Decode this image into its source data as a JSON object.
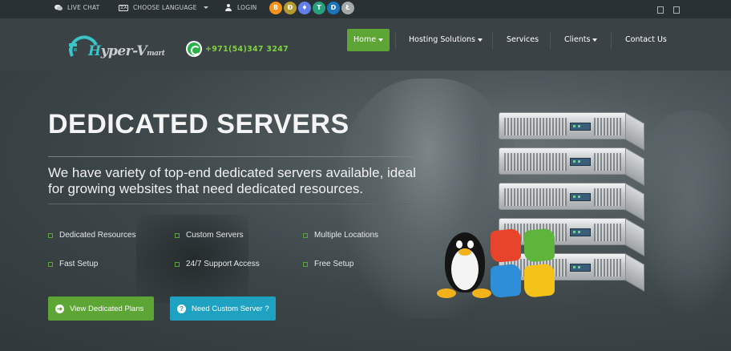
{
  "topbar": {
    "live_chat": "LIVE CHAT",
    "language": "CHOOSE LANGUAGE",
    "lang_icon_text": "文A",
    "login": "LOGIN",
    "coins": [
      {
        "symbol": "B",
        "color": "#f7931a",
        "icon": "bitcoin-icon"
      },
      {
        "symbol": "Ð",
        "color": "#b39a2f",
        "icon": "dogecoin-icon"
      },
      {
        "symbol": "♦",
        "color": "#627eea",
        "icon": "ethereum-icon"
      },
      {
        "symbol": "T",
        "color": "#26a17b",
        "icon": "tether-icon"
      },
      {
        "symbol": "D",
        "color": "#1c75bc",
        "icon": "dash-icon"
      },
      {
        "symbol": "Ł",
        "color": "#a6a9aa",
        "icon": "litecoin-icon"
      }
    ]
  },
  "header": {
    "logo": {
      "pre": "H",
      "main": "yper-V",
      "suffix": "mart"
    },
    "phone": "+971(54)347 3247",
    "nav": [
      {
        "label": "Home",
        "dropdown": true,
        "active": true
      },
      {
        "label": "Hosting Solutions",
        "dropdown": true
      },
      {
        "label": "Services",
        "dropdown": false
      },
      {
        "label": "Clients",
        "dropdown": true
      },
      {
        "label": "Contact Us",
        "dropdown": false
      }
    ]
  },
  "hero": {
    "title": "DEDICATED SERVERS",
    "subtitle": "We have variety of top-end dedicated servers available, ideal for growing websites that need dedicated resources.",
    "features": [
      "Dedicated Resources",
      "Custom Servers",
      "Multiple Locations",
      "Fast Setup",
      "24/7 Support Access",
      "Free Setup"
    ],
    "buttons": {
      "primary": {
        "label": "View Dedicated Plans",
        "icon": "arrow-circle-icon"
      },
      "secondary": {
        "label": "Need Custom Server ?",
        "icon": "question-circle-icon"
      }
    }
  },
  "colors": {
    "accent_green": "#5da534",
    "accent_teal": "#1fa2c1",
    "phone_green": "#7fd33f",
    "logo_teal": "#3ac5c8"
  }
}
